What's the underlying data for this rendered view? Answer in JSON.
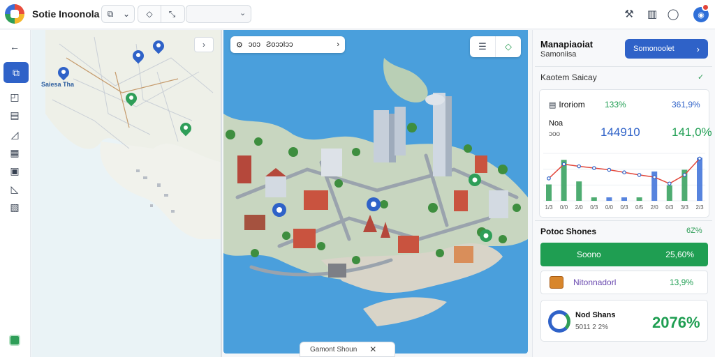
{
  "app": {
    "title": "Sotie Inoonola"
  },
  "toolbar": {
    "group1": [
      "⧉",
      "⌄"
    ],
    "group2": [
      "◇",
      "⤡"
    ],
    "search_placeholder": "",
    "search_icon": "⌄"
  },
  "top_right": {
    "icons": [
      "tools-icon",
      "building-icon",
      "location-icon"
    ]
  },
  "map_left": {
    "label": "Saiesa Tha"
  },
  "scene": {
    "toolbar_text1": "ɔoɔ",
    "toolbar_text2": "ƧoɔɔIɔɔ",
    "toolbar_chevron": "›",
    "bottom_label": "Gamont Shoun",
    "bottom_close": "✕"
  },
  "panel": {
    "title": "Manapiaoiat",
    "subtitle": "Samoniisa",
    "action_button": "Somonoolet",
    "section": "Kaotem Saicay",
    "stats": [
      {
        "label": "Iroriom",
        "v1": "133%",
        "v2": "361,9%"
      },
      {
        "label": "Noa",
        "sub": "ɔoo",
        "v1": "144910",
        "v2": "141,0%"
      }
    ],
    "list_title": "Potoc Shones",
    "list_pct": "6Z%",
    "green_row": {
      "label": "Soono",
      "value": "25,60%"
    },
    "item_row": {
      "label": "Nitonnadorl",
      "value": "13,9%"
    },
    "big_card": {
      "title": "Nod Shans",
      "sub": "5011 2 2%",
      "value": "2076%"
    }
  },
  "chart_data": {
    "type": "bar",
    "categories": [
      "1/3",
      "0/0",
      "2/0",
      "0/3",
      "0/0",
      "0/3",
      "0/5",
      "2/0",
      "0/3",
      "3/3",
      "2/3"
    ],
    "series": [
      {
        "values": [
          38,
          95,
          45,
          8,
          8,
          8,
          8,
          68,
          36,
          72,
          100
        ],
        "color": "#2f9e58"
      },
      {
        "values": [
          52,
          85,
          80,
          76,
          72,
          66,
          60,
          55,
          40,
          60,
          98
        ],
        "color": "#e2463a"
      }
    ],
    "ylim": [
      0,
      110
    ]
  },
  "colors": {
    "accent": "#2f62c8",
    "green": "#1f9e52",
    "water": "#4a9fdc"
  }
}
